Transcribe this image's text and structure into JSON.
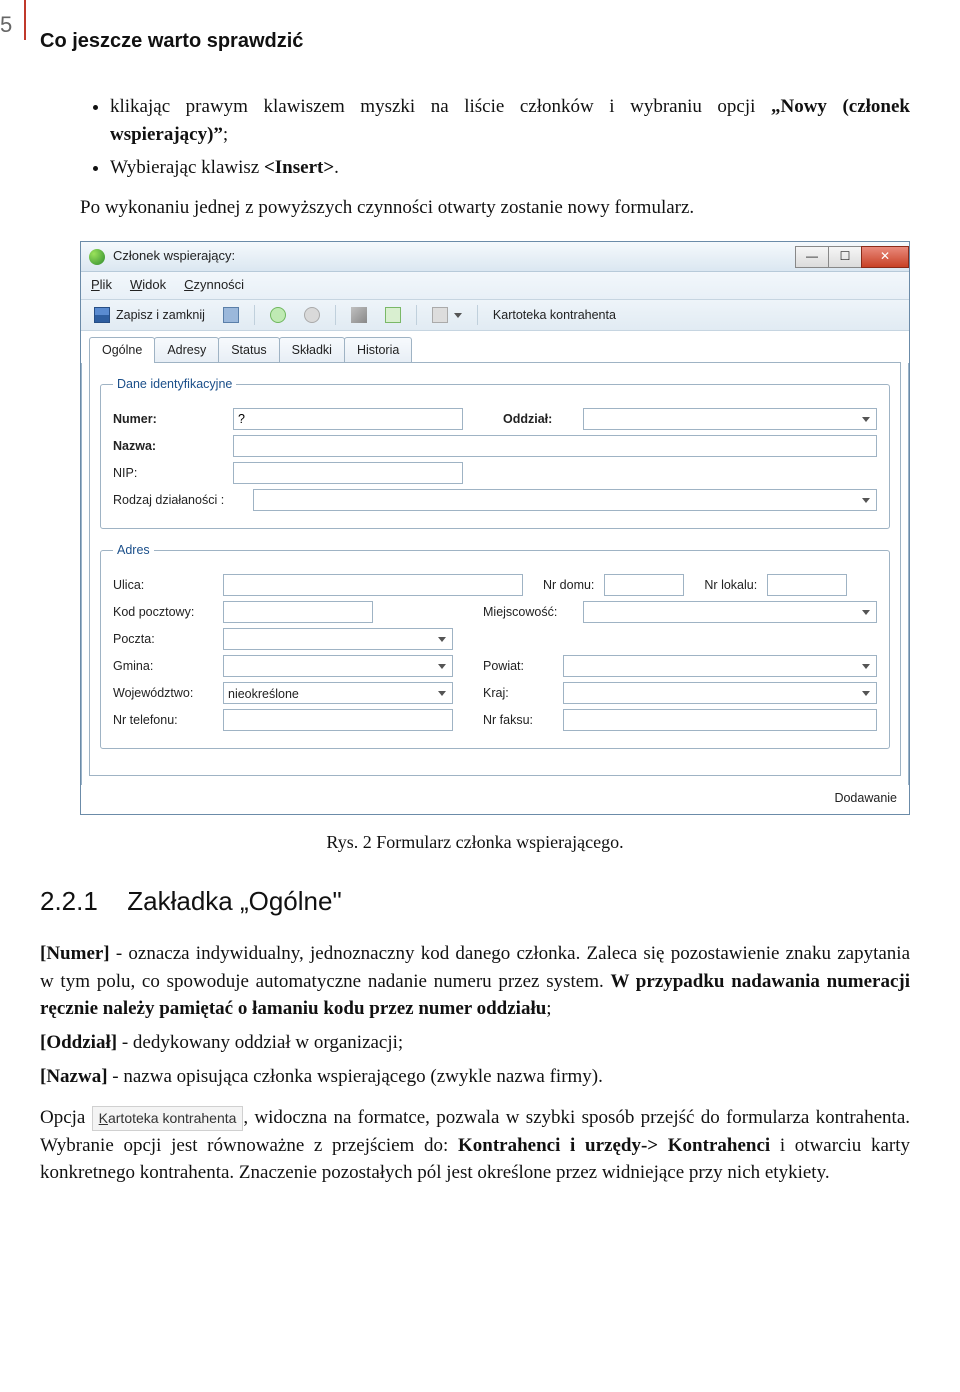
{
  "page_number": "5",
  "header": "Co jeszcze warto sprawdzić",
  "bullets": [
    "klikając prawym klawiszem myszki na liście członków i wybraniu opcji „Nowy (członek wspierający)\";",
    "Wybierając klawisz <Insert>."
  ],
  "intro_para": "Po wykonaniu jednej z powyższych czynności otwarty zostanie nowy formularz.",
  "caption": "Rys. 2 Formularz członka wspierającego.",
  "section": {
    "num": "2.2.1",
    "title": "Zakładka „Ogólne\""
  },
  "desc": {
    "p1a": "[Numer]",
    "p1b": " - oznacza indywidualny, jednoznaczny kod danego członka. Zaleca się pozostawienie znaku zapytania w tym polu, co spowoduje automatyczne nadanie numeru przez system. ",
    "p1c": "W przypadku nadawania numeracji ręcznie należy pamiętać o łamaniu kodu przez numer oddziału",
    "p1d": ";",
    "p2": "[Oddział] - dedykowany oddział w organizacji;",
    "p3": "[Nazwa] - nazwa opisująca członka wspierającego (zwykle nazwa firmy).",
    "p4a": "Opcja ",
    "p4link": "Kartoteka kontrahenta",
    "p4b": ", widoczna na formatce, pozwala w szybki sposób przejść do formularza kontrahenta. Wybranie opcji jest równoważne z przejściem do: ",
    "p4c": "Kontrahenci i urzędy-> Kontrahenci",
    "p4d": " i otwarciu karty konkretnego kontrahenta. Znaczenie pozostałych pól jest określone przez widniejące przy nich etykiety."
  },
  "win": {
    "title": "Członek wspierający:",
    "menu": {
      "plik": "Plik",
      "widok": "Widok",
      "czynnosci": "Czynności"
    },
    "toolbar": {
      "save_close": "Zapisz i zamknij",
      "kartoteka": "Kartoteka kontrahenta"
    },
    "tabs": [
      "Ogólne",
      "Adresy",
      "Status",
      "Składki",
      "Historia"
    ],
    "group1": "Dane identyfikacyjne",
    "labels": {
      "numer": "Numer:",
      "oddzial": "Oddział:",
      "nazwa": "Nazwa:",
      "nip": "NIP:",
      "rodzaj": "Rodzaj działaności :"
    },
    "numer_value": "?",
    "group2": "Adres",
    "addr": {
      "ulica": "Ulica:",
      "nrdomu": "Nr domu:",
      "nrlokalu": "Nr lokalu:",
      "kod": "Kod pocztowy:",
      "miejsc": "Miejscowość:",
      "poczta": "Poczta:",
      "gmina": "Gmina:",
      "powiat": "Powiat:",
      "woj": "Województwo:",
      "woj_val": "nieokreślone",
      "kraj": "Kraj:",
      "tel": "Nr telefonu:",
      "fax": "Nr faksu:"
    },
    "status": "Dodawanie"
  }
}
